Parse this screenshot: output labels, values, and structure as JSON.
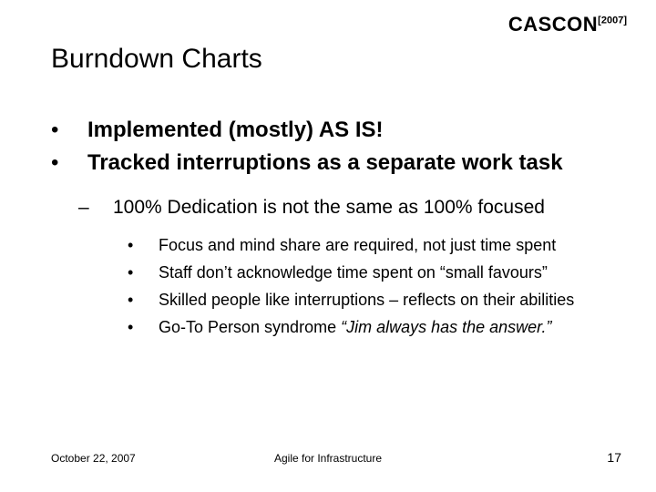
{
  "logo": {
    "name": "CASCON",
    "year_open": "[",
    "year": "2007",
    "year_close": "]"
  },
  "title": "Burndown Charts",
  "bullets_lvl1": [
    "Implemented (mostly) AS IS!",
    "Tracked interruptions as a separate work task"
  ],
  "bullets_lvl2": [
    "100% Dedication is not the same as 100% focused"
  ],
  "bullets_lvl3": [
    "Focus and mind share are required, not just time spent",
    "Staff don’t acknowledge time spent on “small favours”",
    "Skilled people like interruptions – reflects on their abilities"
  ],
  "bullets_lvl3_last": {
    "lead": "Go-To Person syndrome ",
    "quote": "“Jim always has the answer.”"
  },
  "footer": {
    "date": "October 22, 2007",
    "center": "Agile for Infrastructure",
    "page": "17"
  }
}
